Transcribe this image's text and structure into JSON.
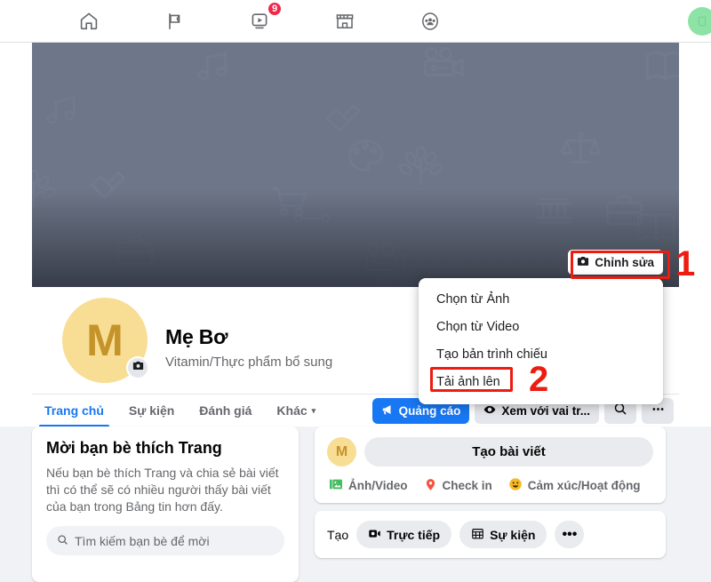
{
  "topnav": {
    "items": [
      {
        "name": "home",
        "icon": "home-icon",
        "label": "Trang chủ"
      },
      {
        "name": "pages",
        "icon": "flag-icon",
        "label": "Trang"
      },
      {
        "name": "watch",
        "icon": "watch-video-icon",
        "label": "Video",
        "badge": "9"
      },
      {
        "name": "marketplace",
        "icon": "marketplace-store-icon",
        "label": "Marketplace"
      },
      {
        "name": "groups",
        "icon": "groups-people-icon",
        "label": "Nhóm"
      }
    ],
    "avatar_color": "#8ce3a5"
  },
  "cover": {
    "background_color": "#6e7789",
    "edit_button_label": "Chỉnh sửa",
    "edit_button_icon": "camera-icon"
  },
  "annotations": {
    "step1": "1",
    "step2": "2",
    "highlight_color": "#ee1b11"
  },
  "dropdown": {
    "items": [
      {
        "label": "Chọn từ Ảnh"
      },
      {
        "label": "Chọn từ Video"
      },
      {
        "label": "Tạo bản trình chiếu"
      },
      {
        "label": "Tải ảnh lên"
      }
    ]
  },
  "profile": {
    "avatar_initial": "M",
    "avatar_color": "#f8dd94",
    "avatar_text_color": "#c4932a",
    "camera_badge_icon": "camera-icon",
    "name": "Mẹ Bơ",
    "category": "Vitamin/Thực phẩm bổ sung"
  },
  "tabs": {
    "items": [
      {
        "label": "Trang chủ",
        "active": true
      },
      {
        "label": "Sự kiện",
        "active": false
      },
      {
        "label": "Đánh giá",
        "active": false
      },
      {
        "label": "Khác",
        "active": false,
        "caret": "▾"
      }
    ],
    "actions": {
      "ads_label": "Quảng cáo",
      "ads_icon": "megaphone-icon",
      "view_as_label": "Xem với vai tr...",
      "view_as_icon": "eye-icon",
      "search_icon": "search-icon",
      "more_icon": "ellipsis-icon",
      "primary_color": "#1877f2"
    }
  },
  "invite_card": {
    "title": "Mời bạn bè thích Trang",
    "description": "Nếu bạn bè thích Trang và chia sẻ bài viết thì có thể sẽ có nhiều người thấy bài viết của bạn trong Bảng tin hơn đấy.",
    "search_placeholder": "Tìm kiếm bạn bè để mời",
    "search_icon": "search-icon"
  },
  "composer": {
    "avatar_initial": "M",
    "input_label": "Tạo bài viết",
    "actions": [
      {
        "label": "Ảnh/Video",
        "icon": "photo-video-icon",
        "color": "#45bd62"
      },
      {
        "label": "Check in",
        "icon": "location-pin-icon",
        "color": "#f5533d"
      },
      {
        "label": "Cảm xúc/Hoạt động",
        "icon": "smiley-icon",
        "color": "#f7b928"
      }
    ]
  },
  "create_bar": {
    "label": "Tạo",
    "chips": [
      {
        "label": "Trực tiếp",
        "icon": "live-video-icon"
      },
      {
        "label": "Sự kiện",
        "icon": "calendar-icon"
      }
    ],
    "more_icon": "ellipsis-icon",
    "more_glyph": "•••"
  }
}
